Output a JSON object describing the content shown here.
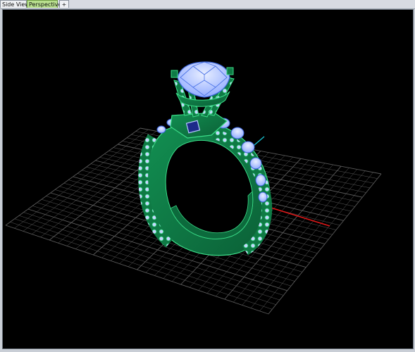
{
  "tabs": [
    {
      "label": "Side View"
    },
    {
      "label": "Perspective"
    },
    {
      "label": "+"
    }
  ],
  "icons": {
    "add_tab": "plus-icon"
  },
  "colors": {
    "viewport_bg": "#000000",
    "grid": "#5a5a5a",
    "x_axis": "#e01818",
    "y_axis": "#19c7d6",
    "metal": "#0f7a45",
    "metal_edge": "#3bdc88",
    "gem": "#b6c8ff",
    "gem_edge": "#3a63d8",
    "active_tab": "#b9e08e"
  }
}
